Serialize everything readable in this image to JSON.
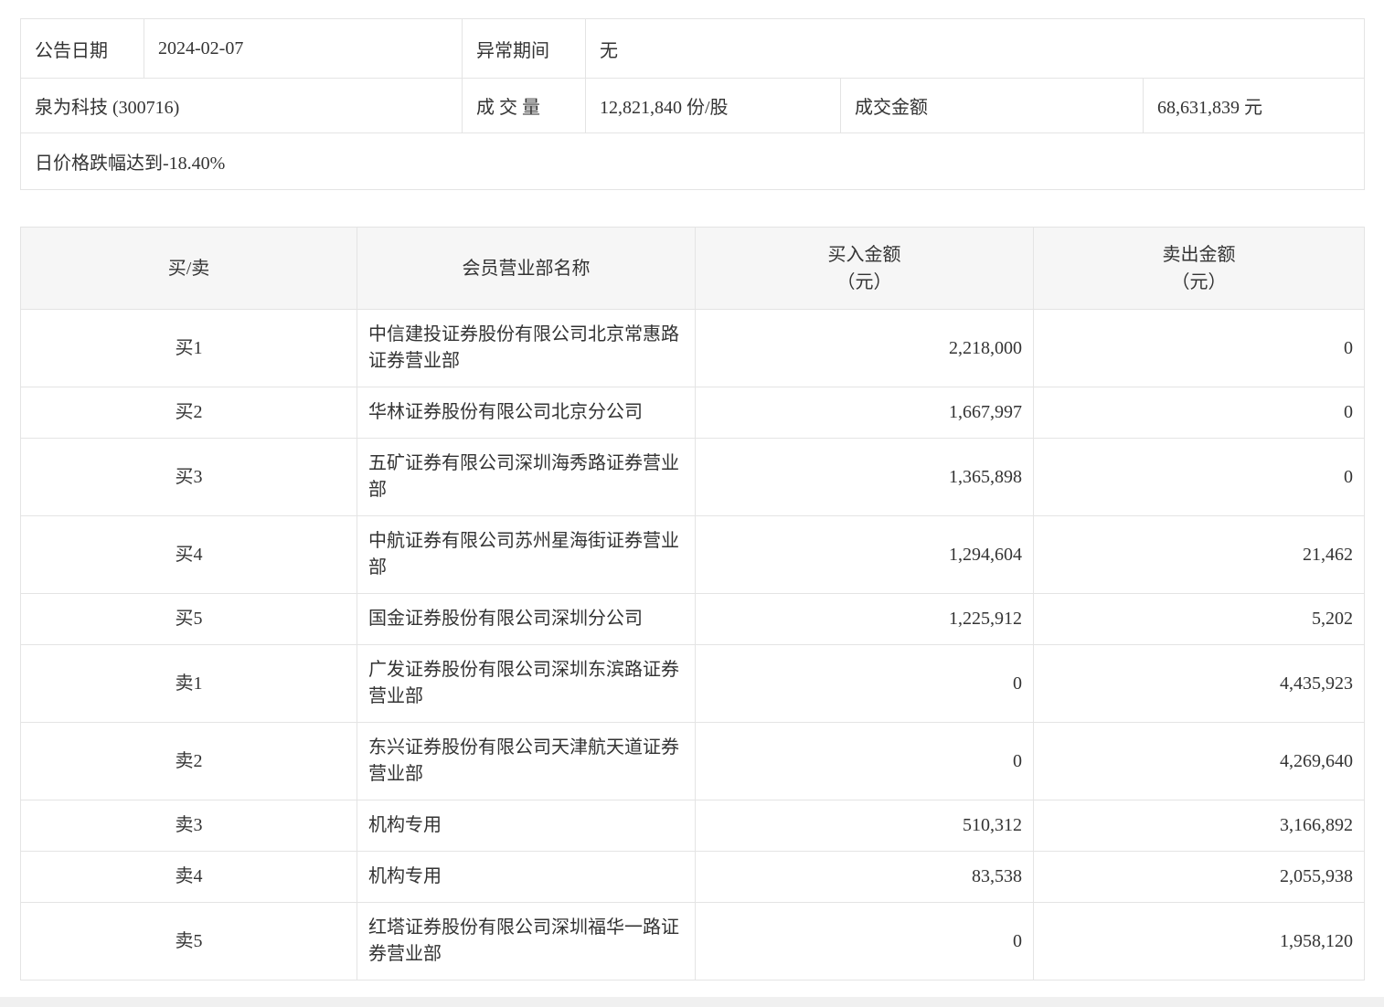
{
  "info": {
    "announce_date_label": "公告日期",
    "announce_date": "2024-02-07",
    "abnormal_period_label": "异常期间",
    "abnormal_period": "无",
    "stock_name": "泉为科技 (300716)",
    "volume_label": "成 交 量",
    "volume": "12,821,840 份/股",
    "turnover_label": "成交金额",
    "turnover": "68,631,839 元",
    "reason": "日价格跌幅达到-18.40%"
  },
  "table": {
    "headers": {
      "side": "买/卖",
      "branch": "会员营业部名称",
      "buy_line1": "买入金额",
      "buy_line2": "（元）",
      "sell_line1": "卖出金额",
      "sell_line2": "（元）"
    },
    "rows": [
      {
        "side": "买1",
        "branch": "中信建投证券股份有限公司北京常惠路证券营业部",
        "buy": "2,218,000",
        "sell": "0"
      },
      {
        "side": "买2",
        "branch": "华林证券股份有限公司北京分公司",
        "buy": "1,667,997",
        "sell": "0"
      },
      {
        "side": "买3",
        "branch": "五矿证券有限公司深圳海秀路证券营业部",
        "buy": "1,365,898",
        "sell": "0"
      },
      {
        "side": "买4",
        "branch": "中航证券有限公司苏州星海街证券营业部",
        "buy": "1,294,604",
        "sell": "21,462"
      },
      {
        "side": "买5",
        "branch": "国金证券股份有限公司深圳分公司",
        "buy": "1,225,912",
        "sell": "5,202"
      },
      {
        "side": "卖1",
        "branch": "广发证券股份有限公司深圳东滨路证券营业部",
        "buy": "0",
        "sell": "4,435,923"
      },
      {
        "side": "卖2",
        "branch": "东兴证券股份有限公司天津航天道证券营业部",
        "buy": "0",
        "sell": "4,269,640"
      },
      {
        "side": "卖3",
        "branch": "机构专用",
        "buy": "510,312",
        "sell": "3,166,892"
      },
      {
        "side": "卖4",
        "branch": "机构专用",
        "buy": "83,538",
        "sell": "2,055,938"
      },
      {
        "side": "卖5",
        "branch": "红塔证券股份有限公司深圳福华一路证券营业部",
        "buy": "0",
        "sell": "1,958,120"
      }
    ]
  },
  "colors": {
    "header_bg": "#f6f6f6",
    "border": "#e4e4e4",
    "text": "#333333",
    "strip_bg": "#f0f0f0"
  }
}
